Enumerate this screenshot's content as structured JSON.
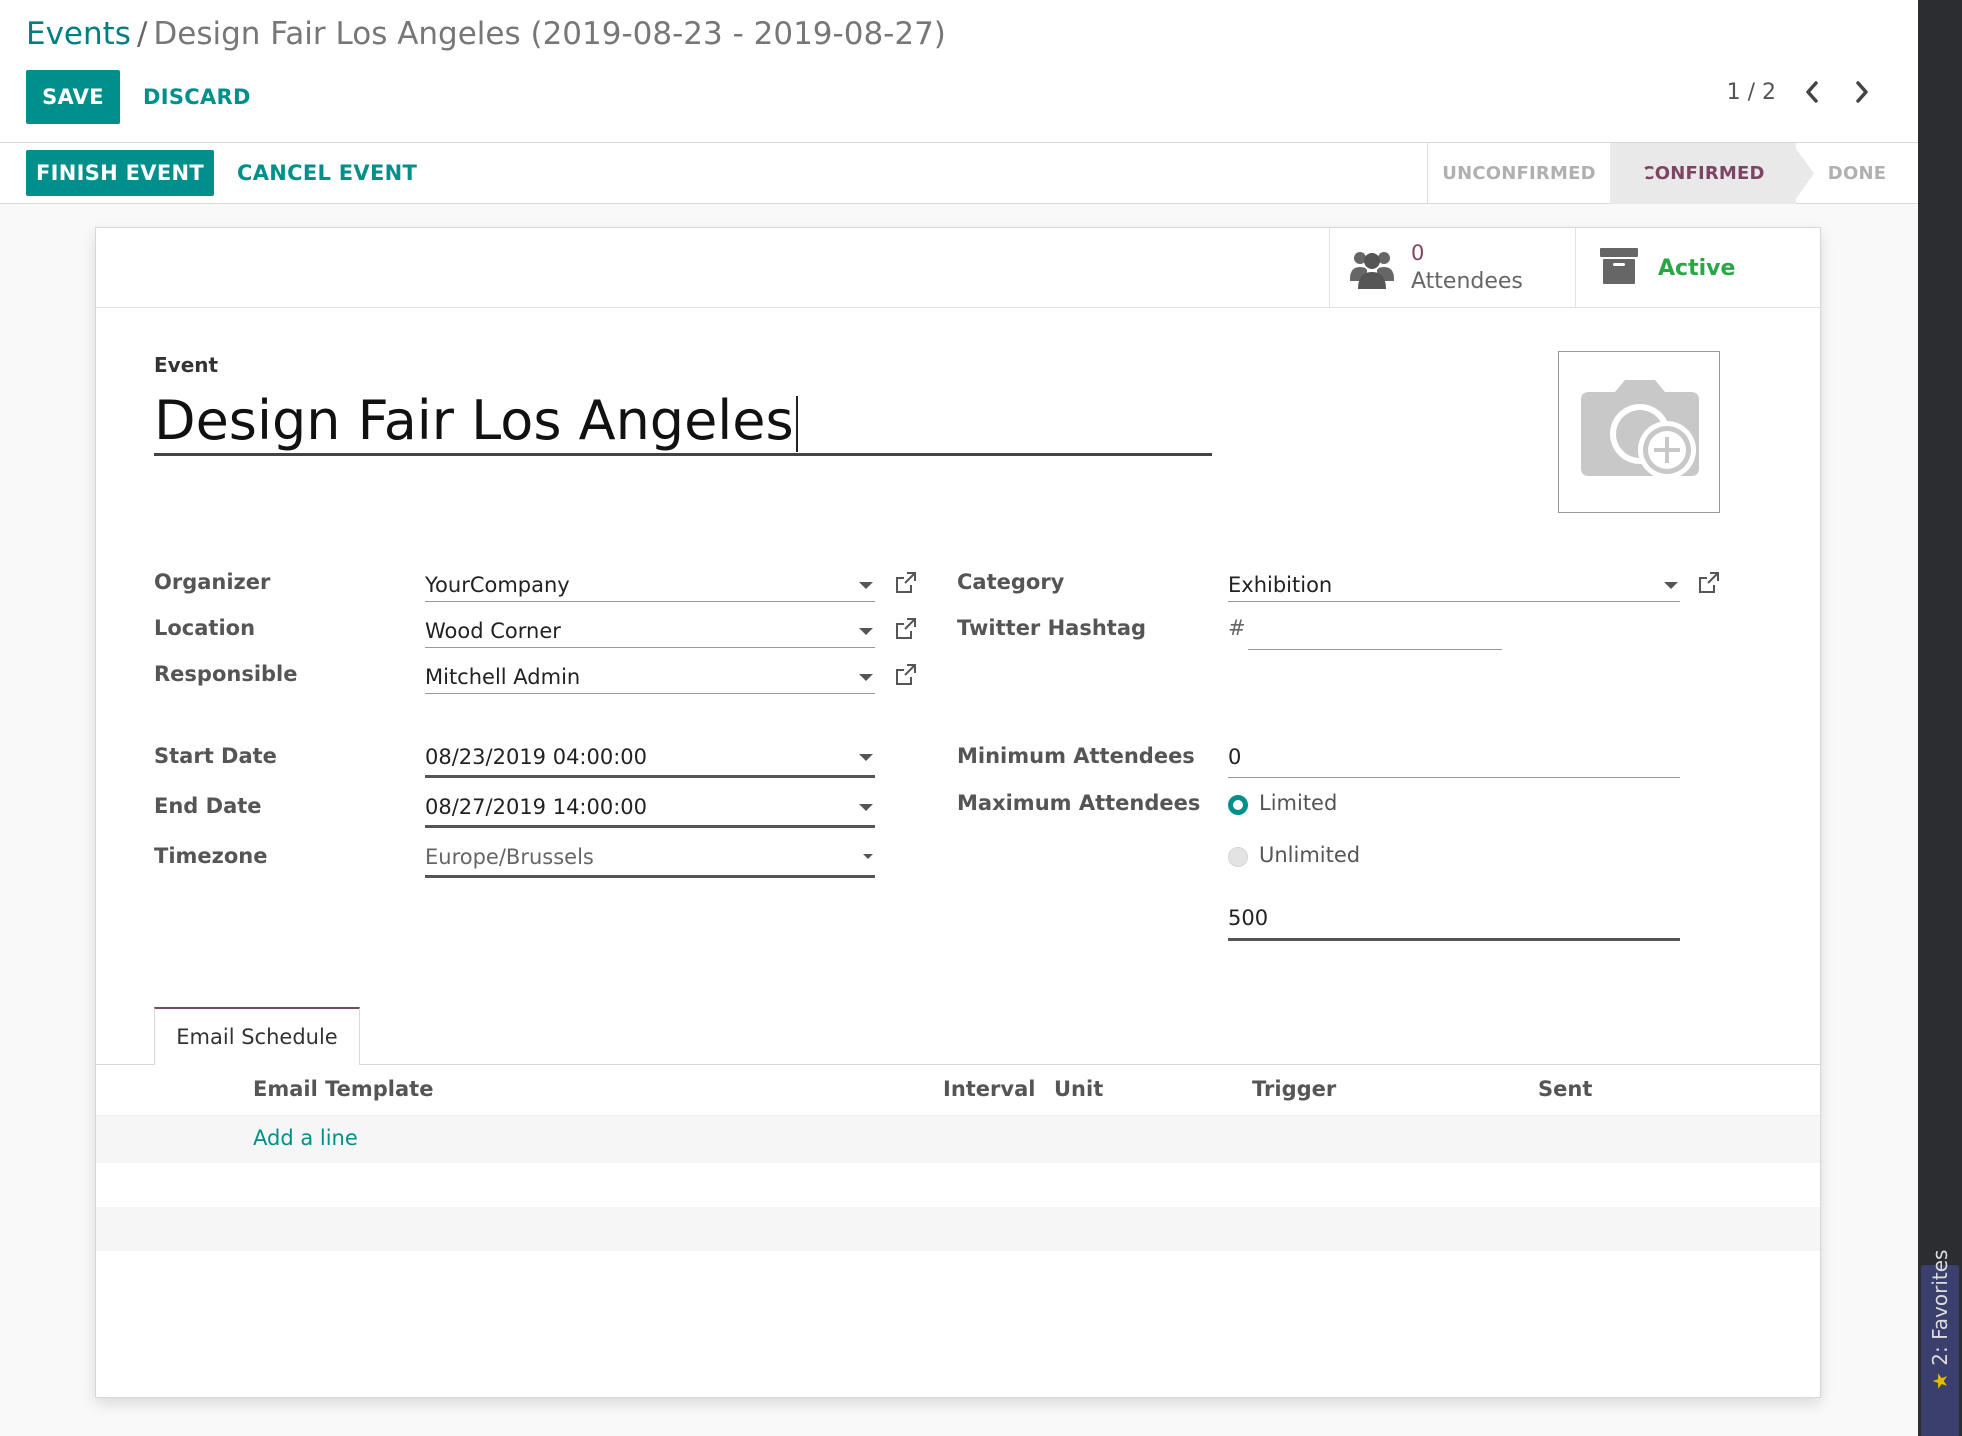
{
  "breadcrumb": {
    "root": "Events",
    "separator": "/",
    "current": "Design Fair Los Angeles (2019-08-23 - 2019-08-27)"
  },
  "toolbar": {
    "save": "SAVE",
    "discard": "DISCARD",
    "pager": "1 / 2"
  },
  "statusbar": {
    "finish": "FINISH EVENT",
    "cancel": "CANCEL EVENT",
    "stages": [
      "UNCONFIRMED",
      "CONFIRMED",
      "DONE"
    ],
    "active_stage": "CONFIRMED"
  },
  "buttonbox": {
    "attendees_count": "0",
    "attendees_label": "Attendees",
    "active_label": "Active"
  },
  "form": {
    "event_label": "Event",
    "event_name": "Design Fair Los Angeles",
    "organizer_label": "Organizer",
    "organizer": "YourCompany",
    "location_label": "Location",
    "location": "Wood Corner",
    "responsible_label": "Responsible",
    "responsible": "Mitchell Admin",
    "start_label": "Start Date",
    "start": "08/23/2019 04:00:00",
    "end_label": "End Date",
    "end": "08/27/2019 14:00:00",
    "tz_label": "Timezone",
    "tz": "Europe/Brussels",
    "category_label": "Category",
    "category": "Exhibition",
    "twitter_label": "Twitter Hashtag",
    "twitter_prefix": "#",
    "twitter": "",
    "min_label": "Minimum Attendees",
    "min": "0",
    "max_label": "Maximum Attendees",
    "limited": "Limited",
    "unlimited": "Unlimited",
    "max_value": "500"
  },
  "tabs": {
    "email_schedule": "Email Schedule"
  },
  "table": {
    "headers": [
      "Email Template",
      "Interval",
      "Unit",
      "Trigger",
      "Sent"
    ],
    "add_line": "Add a line"
  },
  "sidebar": {
    "favorites": "2: Favorites"
  },
  "colors": {
    "primary": "#018f8b",
    "accent": "#7c4563",
    "active_green": "#28a745"
  }
}
